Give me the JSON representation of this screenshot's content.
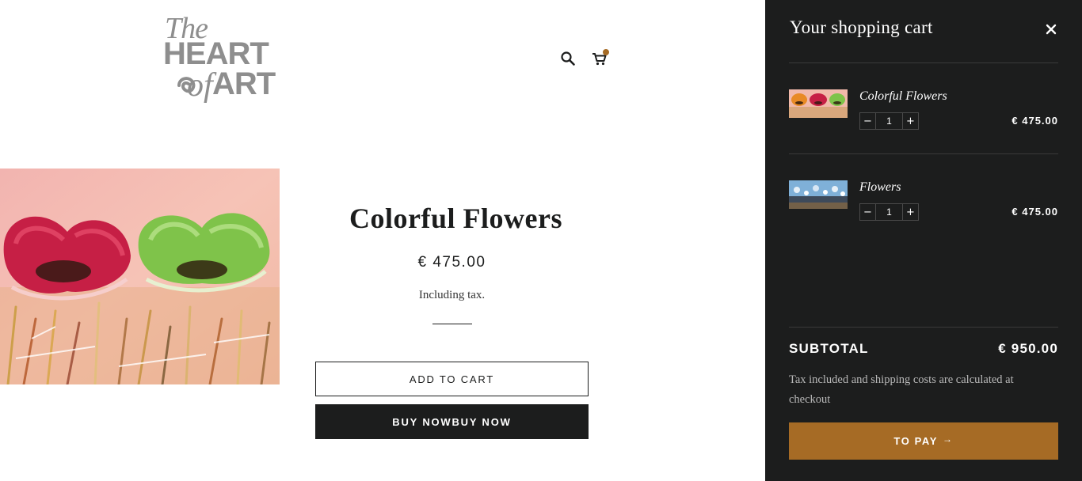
{
  "header": {
    "logo": {
      "line1": "The",
      "line2": "HEART",
      "line3a": "of",
      "line3b": "ART"
    },
    "icons": {
      "search": "search-icon",
      "cart": "cart-icon"
    },
    "cart_has_items": true
  },
  "product": {
    "title": "Colorful Flowers",
    "price": "€ 475.00",
    "tax_note": "Including tax.",
    "add_to_cart_label": "ADD TO CART",
    "buy_now_label": "BUY NOWBUY NOW"
  },
  "cart": {
    "title": "Your shopping cart",
    "close_icon": "close-icon",
    "items": [
      {
        "name": "Colorful Flowers",
        "quantity": "1",
        "price": "€ 475.00",
        "decrement": "−",
        "increment": "+"
      },
      {
        "name": "Flowers",
        "quantity": "1",
        "price": "€ 475.00",
        "decrement": "−",
        "increment": "+"
      }
    ],
    "subtotal_label": "SUBTOTAL",
    "subtotal_value": "€ 950.00",
    "note": "Tax included and shipping costs are calculated at checkout",
    "pay_label": "TO PAY",
    "pay_arrow": "→"
  },
  "colors": {
    "drawer_bg": "#1c1d1d",
    "accent": "#a66b25",
    "logo_gray": "#8e8e8e"
  }
}
